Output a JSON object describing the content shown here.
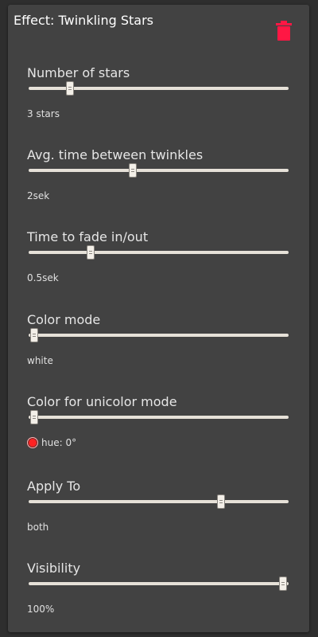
{
  "panel": {
    "title": "Effect: Twinkling Stars",
    "delete_icon": "trash-icon",
    "delete_color": "#ff1744"
  },
  "settings": [
    {
      "id": "number-of-stars",
      "label": "Number of stars",
      "value_text": "3 stars",
      "level_percent": 16
    },
    {
      "id": "avg-time-between-twinkles",
      "label": "Avg. time between twinkles",
      "value_text": "2sek",
      "level_percent": 40
    },
    {
      "id": "time-to-fade",
      "label": "Time to fade in/out",
      "value_text": "0.5sek",
      "level_percent": 24
    },
    {
      "id": "color-mode",
      "label": "Color mode",
      "value_text": "white",
      "level_percent": 2
    },
    {
      "id": "color-for-unicolor-mode",
      "label": "Color for unicolor mode",
      "value_text": "hue: 0°",
      "level_percent": 2,
      "swatch_color": "#ff2222"
    },
    {
      "id": "apply-to",
      "label": "Apply To",
      "value_text": "both",
      "level_percent": 74
    },
    {
      "id": "visibility",
      "label": "Visibility",
      "value_text": "100%",
      "level_percent": 98
    }
  ]
}
